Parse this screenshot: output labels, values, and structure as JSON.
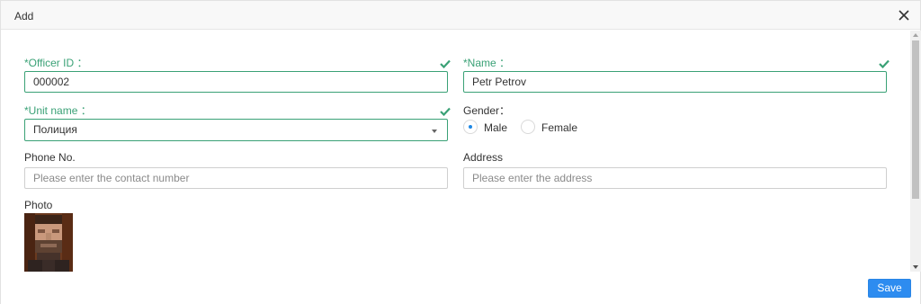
{
  "dialog": {
    "title": "Add",
    "close_icon": "close-icon"
  },
  "form": {
    "officer_id": {
      "label": "Officer ID",
      "colon": "：",
      "required_mark": "*",
      "value": "000002",
      "status_icon": "check-icon"
    },
    "name": {
      "label": "Name",
      "colon": "：",
      "required_mark": "*",
      "value": "Petr Petrov",
      "status_icon": "check-icon"
    },
    "unit_name": {
      "label": "Unit name",
      "colon": "：",
      "required_mark": "*",
      "value": "Полиция",
      "status_icon": "check-icon"
    },
    "gender": {
      "label": "Gender：",
      "options": [
        "Male",
        "Female"
      ],
      "selected": "Male"
    },
    "phone": {
      "label": "Phone No.",
      "placeholder": "Please enter the contact number",
      "value": ""
    },
    "address": {
      "label": "Address",
      "placeholder": "Please enter the address",
      "value": ""
    },
    "photo": {
      "label": "Photo"
    }
  },
  "footer": {
    "save_label": "Save"
  },
  "colors": {
    "valid": "#3aa176",
    "primary": "#2d8cf0",
    "header_bg": "#f8f8f8"
  }
}
